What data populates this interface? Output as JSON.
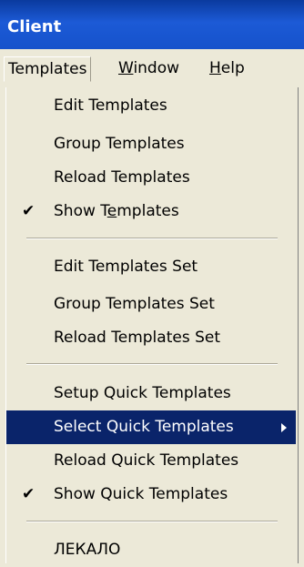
{
  "window": {
    "title": "Client"
  },
  "menubar": {
    "items": [
      {
        "label": "Templates"
      },
      {
        "label_pre": "",
        "mnemonic": "W",
        "label_post": "indow"
      },
      {
        "label_pre": "",
        "mnemonic": "H",
        "label_post": "elp"
      }
    ]
  },
  "menu": {
    "edit_templates": "Edit Templates",
    "group_templates": "Group Templates",
    "reload_templates": "Reload Templates",
    "show_templates": {
      "pre": "Show T",
      "mnemonic": "e",
      "post": "mplates",
      "checked": true
    },
    "edit_templates_set": "Edit Templates Set",
    "group_templates_set": "Group Templates Set",
    "reload_templates_set": "Reload Templates Set",
    "setup_quick_templates": "Setup Quick Templates",
    "select_quick_templates": "Select Quick Templates",
    "reload_quick_templates": "Reload Quick Templates",
    "show_quick_templates": {
      "label": "Show Quick Templates",
      "checked": true
    },
    "lekalo": "ЛЕКАЛО"
  },
  "check_glyph": "✔",
  "colors": {
    "highlight": "#0a246a",
    "menu_bg": "#ece9d8",
    "title_bg": "#1552cb"
  }
}
